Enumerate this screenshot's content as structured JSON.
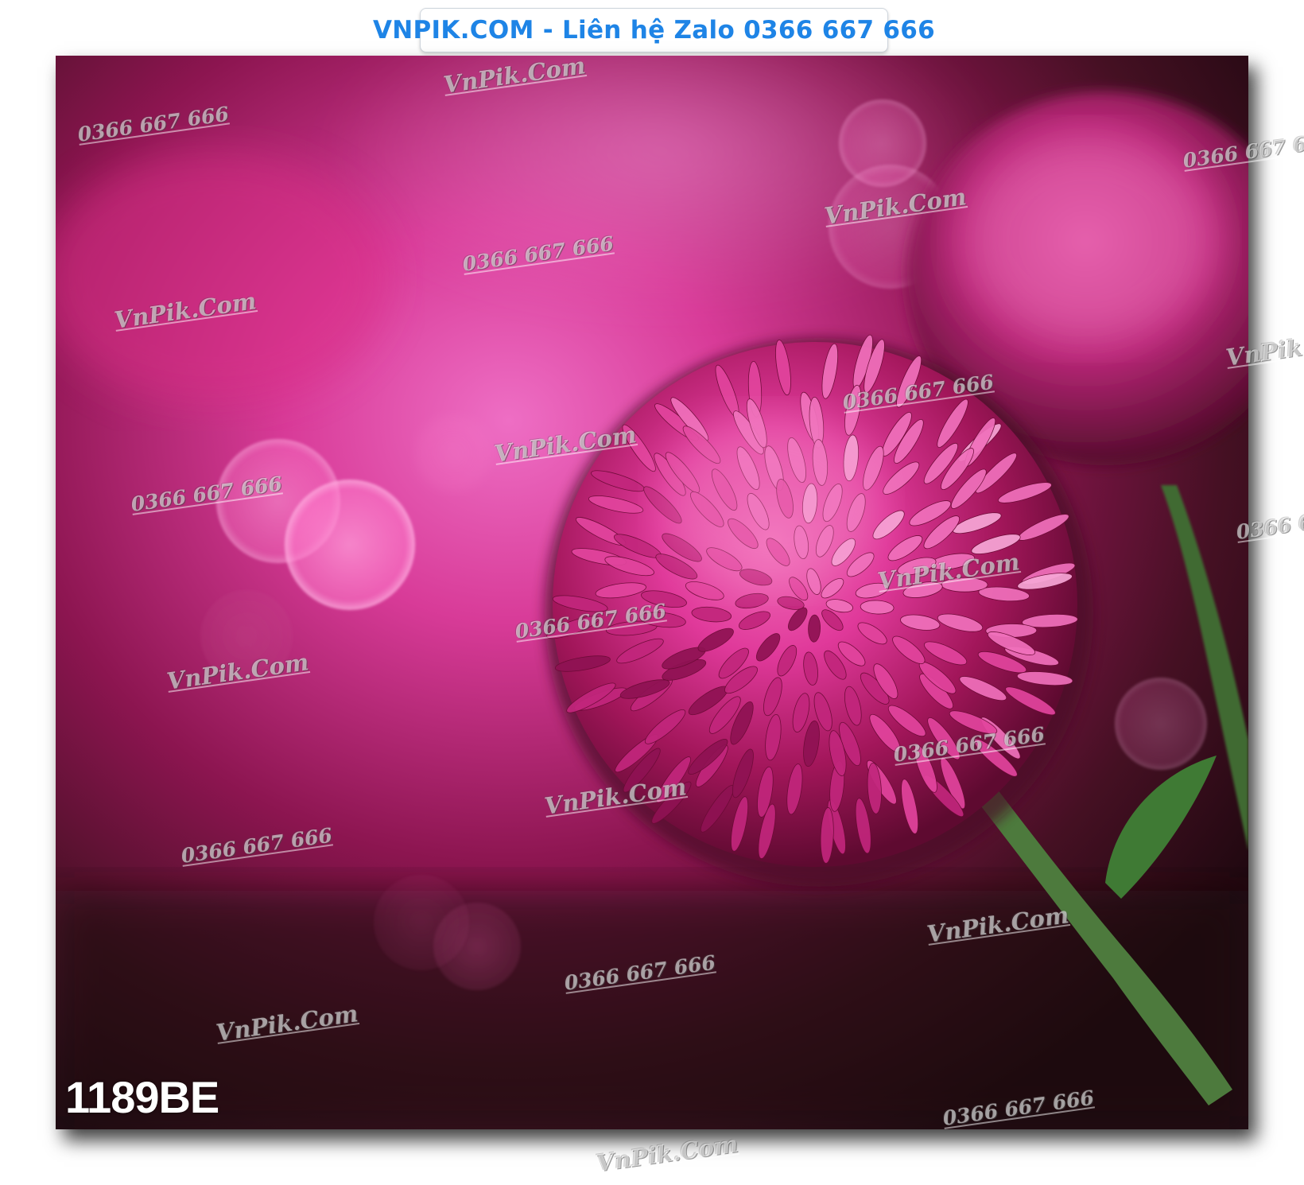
{
  "header": {
    "banner_text": "VNPIK.COM - Liên hệ Zalo 0366 667 666",
    "text_color": "#1e84e6"
  },
  "photo": {
    "subject": "pink-chrysanthemum-flower",
    "product_code": "1189BE",
    "colors": {
      "petal_pink": "#e23f98",
      "petal_dark": "#8a0f4a",
      "background_pink": "#d6379a",
      "background_dark": "#2a0a14",
      "stem_green": "#4d7a3d"
    }
  },
  "watermarks": {
    "brand": "VnPik.Com",
    "phone": "0366 667 666"
  }
}
